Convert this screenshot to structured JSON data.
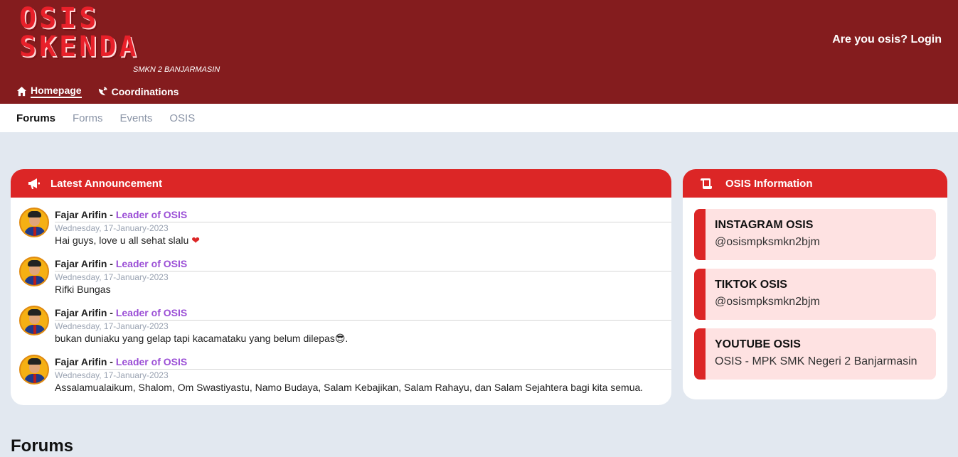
{
  "header": {
    "logo_line1": "OSIS",
    "logo_line2": "SKENDA",
    "logo_subtitle": "SMKN 2 BANJARMASIN",
    "login_text": "Are you osis? Login",
    "nav": [
      {
        "label": "Homepage",
        "icon": "home-icon"
      },
      {
        "label": "Coordinations",
        "icon": "satellite-dish-icon"
      }
    ]
  },
  "subnav": [
    "Forums",
    "Forms",
    "Events",
    "OSIS"
  ],
  "announcements": {
    "title": "Latest Announcement",
    "icon": "megaphone-icon",
    "items": [
      {
        "author": "Fajar Arifin",
        "separator": " - ",
        "role": "Leader of OSIS",
        "date": "Wednesday, 17-January-2023",
        "text": "Hai guys, love u all sehat slalu",
        "emoji": "❤"
      },
      {
        "author": "Fajar Arifin",
        "separator": " - ",
        "role": "Leader of OSIS",
        "date": "Wednesday, 17-January-2023",
        "text": "Rifki Bungas",
        "emoji": ""
      },
      {
        "author": "Fajar Arifin",
        "separator": " - ",
        "role": "Leader of OSIS",
        "date": "Wednesday, 17-January-2023",
        "text": "bukan duniaku yang gelap tapi kacamataku yang belum dilepas",
        "emoji": "😎."
      },
      {
        "author": "Fajar Arifin",
        "separator": " - ",
        "role": "Leader of OSIS",
        "date": "Wednesday, 17-January-2023",
        "text": "Assalamualaikum, Shalom, Om Swastiyastu, Namo Budaya, Salam Kebajikan, Salam Rahayu, dan Salam Sejahtera bagi kita semua.",
        "emoji": ""
      }
    ]
  },
  "info": {
    "title": "OSIS Information",
    "icon": "scroll-icon",
    "items": [
      {
        "title": "INSTAGRAM OSIS",
        "value": "@osismpksmkn2bjm"
      },
      {
        "title": "TIKTOK OSIS",
        "value": "@osismpksmkn2bjm"
      },
      {
        "title": "YOUTUBE OSIS",
        "value": "OSIS - MPK SMK Negeri 2 Banjarmasin"
      }
    ]
  },
  "forums_title": "Forums",
  "colors": {
    "header_bg": "#841c1e",
    "accent_red": "#dc2626",
    "role_purple": "#9b4fd6",
    "page_bg": "#e2e8f0",
    "info_item_bg": "#fee2e2"
  }
}
